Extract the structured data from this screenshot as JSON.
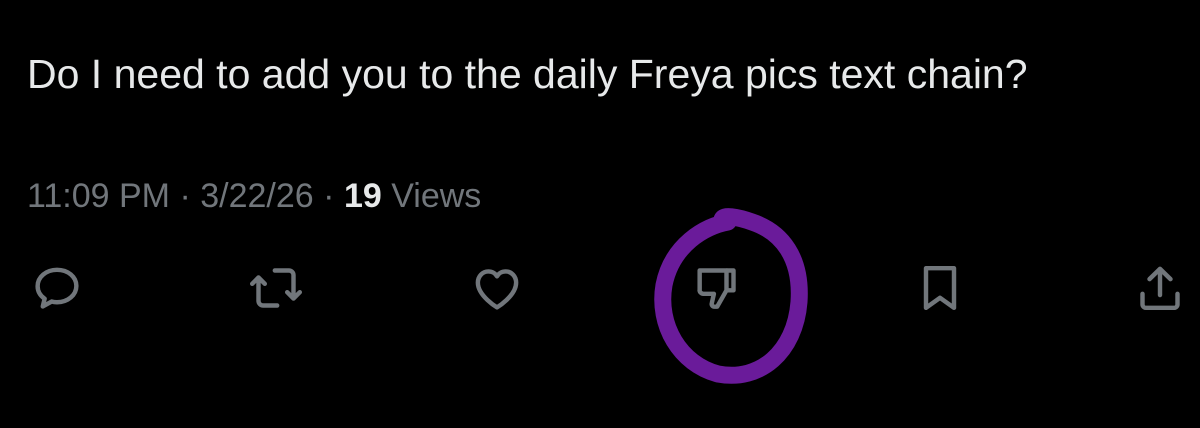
{
  "tweet": {
    "text": "Do I need to add you to the daily Freya pics text chain?",
    "time": "11:09 PM",
    "date": "3/22/26",
    "separator": "·",
    "views_count": "19",
    "views_label": "Views"
  },
  "actions": [
    {
      "name": "reply",
      "icon": "speech-bubble-icon"
    },
    {
      "name": "repost",
      "icon": "repost-arrows-icon"
    },
    {
      "name": "like",
      "icon": "heart-icon"
    },
    {
      "name": "dislike",
      "icon": "thumbs-down-icon"
    },
    {
      "name": "bookmark",
      "icon": "bookmark-icon"
    },
    {
      "name": "share",
      "icon": "share-upload-icon"
    }
  ],
  "colors": {
    "background": "#000000",
    "primary_text": "#e7e9ea",
    "secondary_text": "#71767b",
    "annotation_circle": "#6a1b9a"
  }
}
